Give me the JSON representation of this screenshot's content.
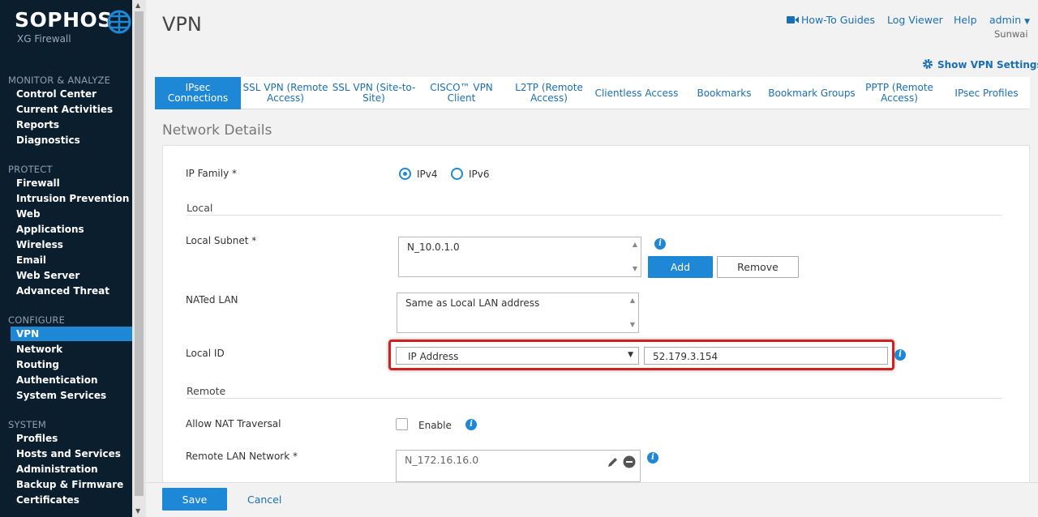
{
  "sidebar": {
    "brand": "SOPHOS",
    "product": "XG Firewall",
    "sections": [
      {
        "title": "MONITOR & ANALYZE",
        "items": [
          "Control Center",
          "Current Activities",
          "Reports",
          "Diagnostics"
        ]
      },
      {
        "title": "PROTECT",
        "items": [
          "Firewall",
          "Intrusion Prevention",
          "Web",
          "Applications",
          "Wireless",
          "Email",
          "Web Server",
          "Advanced Threat"
        ]
      },
      {
        "title": "CONFIGURE",
        "items": [
          "VPN",
          "Network",
          "Routing",
          "Authentication",
          "System Services"
        ]
      },
      {
        "title": "SYSTEM",
        "items": [
          "Profiles",
          "Hosts and Services",
          "Administration",
          "Backup & Firmware",
          "Certificates"
        ]
      }
    ],
    "active_item": "VPN"
  },
  "header": {
    "title": "VPN",
    "links": {
      "how_to": "How-To Guides",
      "log_viewer": "Log Viewer",
      "help": "Help",
      "admin": "admin",
      "org": "Sunwai"
    },
    "show_vpn_settings": "Show VPN Settings"
  },
  "tabs": [
    "IPsec Connections",
    "SSL VPN (Remote Access)",
    "SSL VPN (Site-to-Site)",
    "CISCO™ VPN Client",
    "L2TP (Remote Access)",
    "Clientless Access",
    "Bookmarks",
    "Bookmark Groups",
    "PPTP (Remote Access)",
    "IPsec Profiles"
  ],
  "active_tab": "IPsec Connections",
  "form": {
    "section_title": "Network Details",
    "ip_family_label": "IP Family *",
    "ipv4": "IPv4",
    "ipv6": "IPv6",
    "ip_family_selected": "IPv4",
    "local_heading": "Local",
    "local_subnet_label": "Local Subnet *",
    "local_subnet_value": "N_10.0.1.0",
    "add_label": "Add",
    "remove_label": "Remove",
    "nated_lan_label": "NATed LAN",
    "nated_lan_value": "Same as Local LAN address",
    "local_id_label": "Local ID",
    "local_id_type": "IP Address",
    "local_id_value": "52.179.3.154",
    "remote_heading": "Remote",
    "nat_traversal_label": "Allow NAT Traversal",
    "enable_label": "Enable",
    "remote_lan_label": "Remote LAN Network *",
    "remote_lan_value": "N_172.16.16.0"
  },
  "footer": {
    "save": "Save",
    "cancel": "Cancel"
  },
  "colors": {
    "sidebar_bg": "#0b1e2e",
    "accent": "#1f88d6",
    "link": "#1a6fb3",
    "highlight": "#d02020"
  }
}
